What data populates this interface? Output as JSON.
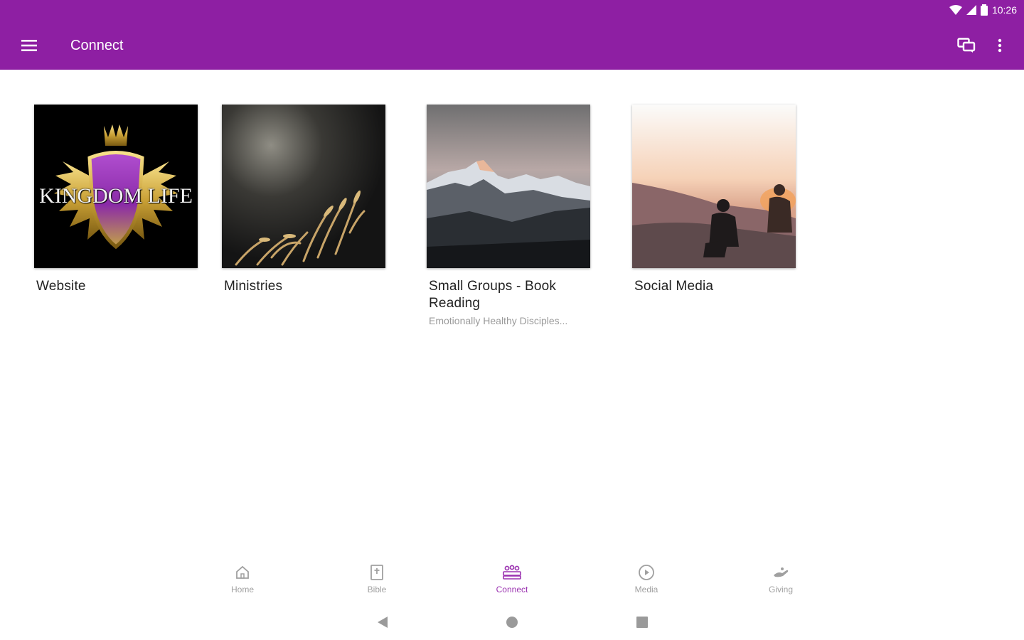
{
  "status": {
    "time": "10:26"
  },
  "appbar": {
    "title": "Connect",
    "menu_icon": "hamburger-icon",
    "chat_icon": "chat-icon",
    "more_icon": "more-vert-icon",
    "color": "#8e1fa3"
  },
  "cards": [
    {
      "title": "Website",
      "subtitle": "",
      "logo_text": "KINGDOM LIFE"
    },
    {
      "title": "Ministries",
      "subtitle": ""
    },
    {
      "title": "Small Groups - Book Reading",
      "subtitle": "Emotionally Healthy Disciples..."
    },
    {
      "title": "Social Media",
      "subtitle": ""
    }
  ],
  "bottom_nav": [
    {
      "label": "Home",
      "icon": "home-icon",
      "active": false
    },
    {
      "label": "Bible",
      "icon": "bible-icon",
      "active": false
    },
    {
      "label": "Connect",
      "icon": "connect-icon",
      "active": true
    },
    {
      "label": "Media",
      "icon": "play-icon",
      "active": false
    },
    {
      "label": "Giving",
      "icon": "giving-icon",
      "active": false
    }
  ],
  "accent_color": "#9b32b0"
}
